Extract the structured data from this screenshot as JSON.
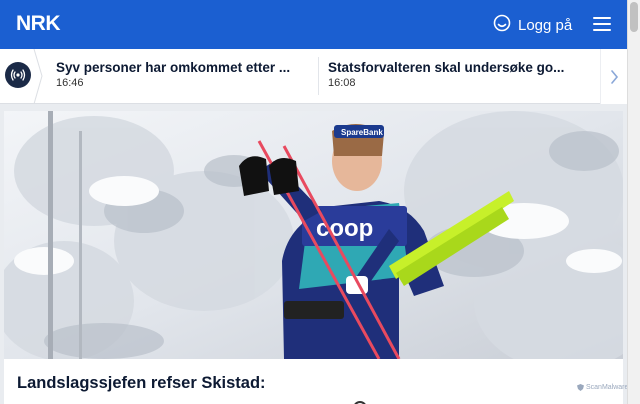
{
  "header": {
    "logo": "NRK",
    "login_label": "Logg på",
    "menu_icon": "hamburger-icon"
  },
  "ticker": {
    "live_icon": "live-broadcast-icon",
    "items": [
      {
        "title": "Syv personer har omkommet etter ...",
        "time": "16:46"
      },
      {
        "title": "Statsforvalteren skal undersøke go...",
        "time": "16:08"
      }
    ],
    "next_icon": "chevron-right-icon"
  },
  "article": {
    "image_alt": "Skiløper med staver og ski på skulderen i snødekt skog",
    "bib_sponsor": "coop",
    "headband": "SpareBank",
    "headline": "Landslagssjefen refser Skistad:"
  },
  "watermark": "ScanMalware",
  "colors": {
    "brand_blue": "#1b5fd1",
    "text_dark": "#0d1a33",
    "live_bg": "#1b2a47"
  }
}
